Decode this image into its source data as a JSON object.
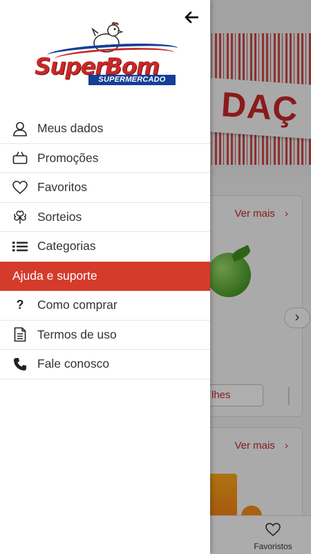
{
  "background": {
    "banner_text": "DAÇ",
    "cards": [
      {
        "link": "Ver mais",
        "chevron": "›",
        "button": "lhes"
      },
      {
        "link": "Ver mais",
        "chevron": "›"
      }
    ],
    "next_chevron": "›",
    "bottom_tab_label": "Favoristos",
    "bottom_tab_icon": "heart-outline-icon"
  },
  "drawer": {
    "back_icon": "arrow-left-icon",
    "logo": {
      "title": "SuperBom",
      "subtitle": "SUPERMERCADO"
    },
    "items": [
      {
        "label": "Meus dados",
        "icon": "user-icon"
      },
      {
        "label": "Promoções",
        "icon": "shopping-bag-icon"
      },
      {
        "label": "Favoritos",
        "icon": "heart-icon"
      },
      {
        "label": "Sorteios",
        "icon": "clover-icon"
      },
      {
        "label": "Categorias",
        "icon": "list-icon"
      }
    ],
    "section_header": "Ajuda e suporte",
    "help_items": [
      {
        "label": "Como comprar",
        "icon": "question-icon",
        "glyph": "?"
      },
      {
        "label": "Termos de uso",
        "icon": "document-icon"
      },
      {
        "label": "Fale conosco",
        "icon": "phone-icon"
      }
    ]
  },
  "colors": {
    "accent": "#d43b2a",
    "brand_blue": "#153f98",
    "text": "#333333"
  }
}
